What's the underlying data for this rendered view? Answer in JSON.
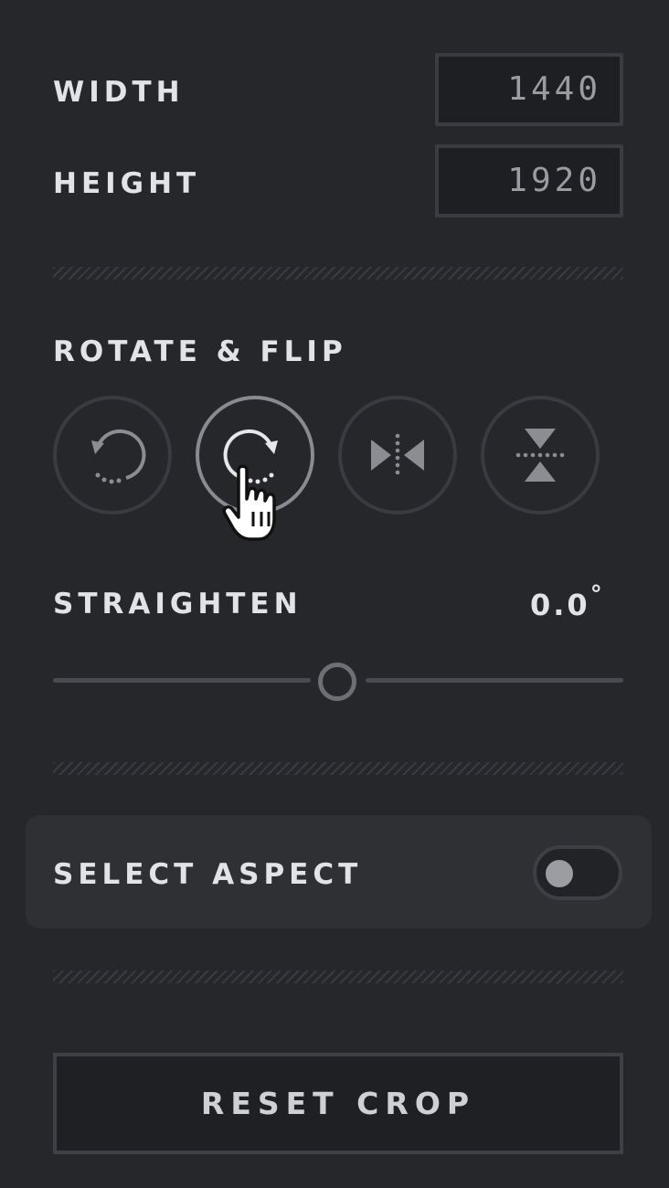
{
  "dimensions": {
    "width_label": "WIDTH",
    "width_value": "1440",
    "height_label": "HEIGHT",
    "height_value": "1920"
  },
  "rotate_flip": {
    "heading": "ROTATE & FLIP",
    "buttons": [
      {
        "icon": "rotate-left-icon",
        "active": false
      },
      {
        "icon": "rotate-right-icon",
        "active": true
      },
      {
        "icon": "flip-horizontal-icon",
        "active": false
      },
      {
        "icon": "flip-vertical-icon",
        "active": false
      }
    ]
  },
  "straighten": {
    "label": "STRAIGHTEN",
    "value": "0.0",
    "unit": "°",
    "slider_fraction": 0.5
  },
  "aspect": {
    "label": "SELECT ASPECT",
    "toggle_on": false
  },
  "reset": {
    "label": "RESET CROP"
  },
  "colors": {
    "background": "#26272b",
    "text": "#e2e3e5",
    "field_text": "#9b9ca1",
    "border": "#3a3b40",
    "active_border": "#8a8b90"
  }
}
